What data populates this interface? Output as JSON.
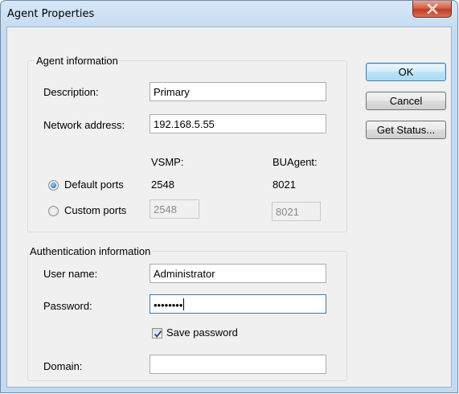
{
  "window": {
    "title": "Agent Properties"
  },
  "agent_info": {
    "group_title": "Agent information",
    "description_label": "Description:",
    "description_value": "Primary",
    "network_label": "Network address:",
    "network_value": "192.168.5.55",
    "vsmp_header": "VSMP:",
    "buagent_header": "BUAgent:",
    "default_ports_label": "Default ports",
    "default_vsmp": "2548",
    "default_buagent": "8021",
    "custom_ports_label": "Custom ports",
    "custom_vsmp": "2548",
    "custom_buagent": "8021",
    "selected_ports": "Default ports"
  },
  "auth_info": {
    "group_title": "Authentication information",
    "username_label": "User name:",
    "username_value": "Administrator",
    "password_label": "Password:",
    "password_mask": "••••••••",
    "save_password_label": "Save password",
    "save_password_checked": true,
    "domain_label": "Domain:",
    "domain_value": ""
  },
  "buttons": {
    "ok": "OK",
    "cancel": "Cancel",
    "get_status": "Get Status..."
  },
  "colors": {
    "titlebar": "#c4daf0",
    "close_button": "#c23b22",
    "dialog_bg": "#f0f0f0",
    "accent": "#3c7fb1"
  },
  "icons": {
    "close": "close-x-icon",
    "check": "checkmark-icon"
  }
}
